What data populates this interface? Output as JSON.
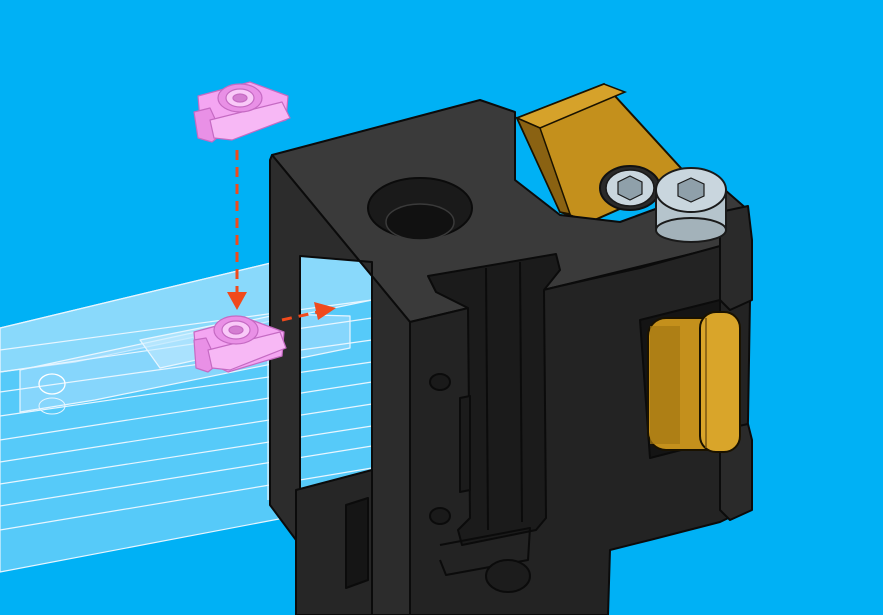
{
  "scene": {
    "background": "#00b1f5",
    "part_color": "#2b2b2b",
    "part_edge": "#0b0b0b",
    "brass_color": "#c4901c",
    "brass_dark": "#7a5610",
    "nut_color": "#f4a6f2",
    "nut_edge": "#c56ac3",
    "arrow_color": "#f04a1c",
    "extrusion_fill": "#bfe8ff",
    "bolt_color": "#c9d6de"
  },
  "callouts": {
    "drop_arrow": "insert-vertical",
    "slide_arrow": "slide-horizontal"
  }
}
